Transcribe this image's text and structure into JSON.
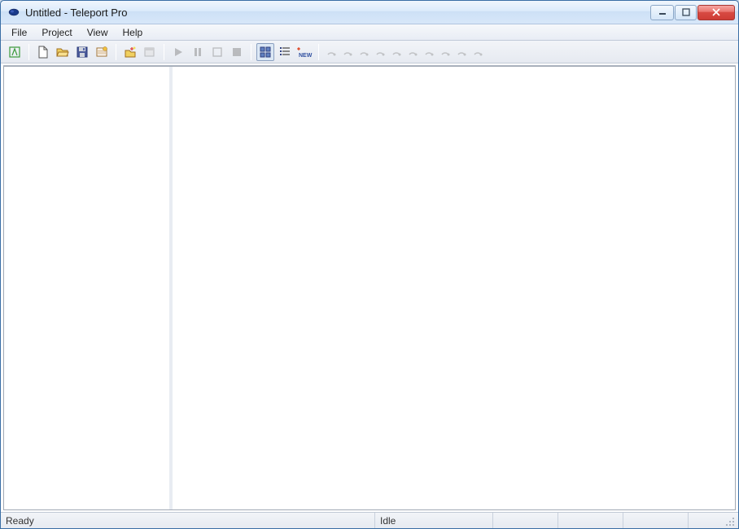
{
  "window": {
    "title": "Untitled - Teleport Pro"
  },
  "menubar": {
    "items": [
      {
        "label": "File"
      },
      {
        "label": "Project"
      },
      {
        "label": "View"
      },
      {
        "label": "Help"
      }
    ]
  },
  "toolbar": {
    "icons": {
      "wizard": "wizard",
      "new": "new",
      "open": "open",
      "save": "save",
      "properties": "properties",
      "new_address": "new-address",
      "abort_browser": "abort-browser",
      "run": "run",
      "pause": "pause",
      "stop": "stop",
      "abort": "abort",
      "large_icons": "large-icons",
      "small_icons": "small-icons",
      "update": "update"
    }
  },
  "statusbar": {
    "ready": "Ready",
    "idle": "Idle"
  }
}
